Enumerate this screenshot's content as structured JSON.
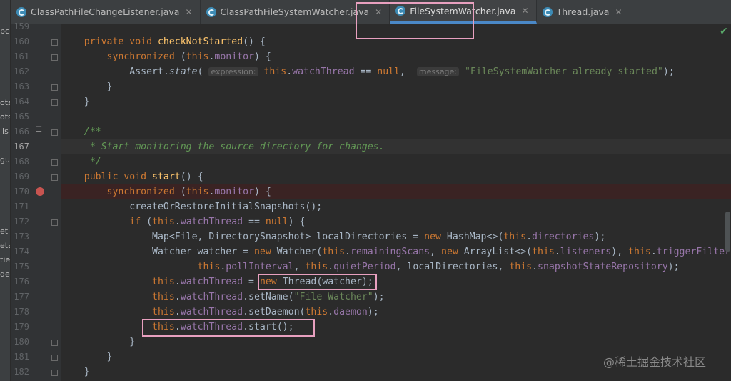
{
  "tabs": [
    {
      "label": "ClassPathFileChangeListener.java",
      "active": false
    },
    {
      "label": "ClassPathFileSystemWatcher.java",
      "active": false
    },
    {
      "label": "FileSystemWatcher.java",
      "active": true
    },
    {
      "label": "Thread.java",
      "active": false
    }
  ],
  "left_panel_fragments": [
    "pc",
    "ots",
    "ots",
    "lis",
    "gui",
    "et",
    "eta",
    "tie",
    "de"
  ],
  "status": {
    "inspection_ok": "✔"
  },
  "watermark": "@稀土掘金技术社区",
  "lines": [
    {
      "n": "159",
      "html": ""
    },
    {
      "n": "160",
      "html": "    <span class=\"k\">private void </span><span class=\"f\">checkNotStarted</span>() {"
    },
    {
      "n": "161",
      "html": "        <span class=\"k\">synchronized </span>(<span class=\"k\">this</span>.<span class=\"fd\">monitor</span>) {"
    },
    {
      "n": "162",
      "html": "            Assert.<span class=\"m\">state</span>( <span class=\"hint\">expression:</span> <span class=\"k\">this</span>.<span class=\"fd\">watchThread</span> == <span class=\"k\">null</span>,  <span class=\"hint\">message:</span> <span class=\"s\">\"FileSystemWatcher already started\"</span>);"
    },
    {
      "n": "163",
      "html": "        }"
    },
    {
      "n": "164",
      "html": "    }"
    },
    {
      "n": "165",
      "html": ""
    },
    {
      "n": "166",
      "html": "    <span class=\"c\">/**</span>"
    },
    {
      "n": "167",
      "html": "<span class=\"c\">     * Start monitoring the source directory for changes.</span><span class=\"caret\"></span>"
    },
    {
      "n": "168",
      "html": "<span class=\"c\">     */</span>"
    },
    {
      "n": "169",
      "html": "    <span class=\"k\">public void </span><span class=\"f\">start</span>() {"
    },
    {
      "n": "170",
      "html": "        <span class=\"k\">synchronized </span>(<span class=\"k\">this</span>.<span class=\"fd\">monitor</span>) {"
    },
    {
      "n": "171",
      "html": "            createOrRestoreInitialSnapshots();"
    },
    {
      "n": "172",
      "html": "            <span class=\"k\">if </span>(<span class=\"k\">this</span>.<span class=\"fd\">watchThread</span> == <span class=\"k\">null</span>) {"
    },
    {
      "n": "173",
      "html": "                Map&lt;File, DirectorySnapshot&gt; localDirectories = <span class=\"k\">new </span>HashMap&lt;&gt;(<span class=\"k\">this</span>.<span class=\"fd\">directories</span>);"
    },
    {
      "n": "174",
      "html": "                Watcher watcher = <span class=\"k\">new </span>Watcher(<span class=\"k\">this</span>.<span class=\"fd\">remainingScans</span>, <span class=\"k\">new </span>ArrayList&lt;&gt;(<span class=\"k\">this</span>.<span class=\"fd\">listeners</span>), <span class=\"k\">this</span>.<span class=\"fd\">triggerFilter</span>,"
    },
    {
      "n": "175",
      "html": "                        <span class=\"k\">this</span>.<span class=\"fd\">pollInterval</span>, <span class=\"k\">this</span>.<span class=\"fd\">quietPeriod</span>, localDirectories, <span class=\"k\">this</span>.<span class=\"fd\">snapshotStateRepository</span>);"
    },
    {
      "n": "176",
      "html": "                <span class=\"k\">this</span>.<span class=\"fd\">watchThread</span> = <span class=\"k\">new </span>Thread(watcher);"
    },
    {
      "n": "177",
      "html": "                <span class=\"k\">this</span>.<span class=\"fd\">watchThread</span>.setName(<span class=\"s\">\"File Watcher\"</span>);"
    },
    {
      "n": "178",
      "html": "                <span class=\"k\">this</span>.<span class=\"fd\">watchThread</span>.setDaemon(<span class=\"k\">this</span>.<span class=\"fd\">daemon</span>);"
    },
    {
      "n": "179",
      "html": "                <span class=\"k\">this</span>.<span class=\"fd\">watchThread</span>.start();"
    },
    {
      "n": "180",
      "html": "            }"
    },
    {
      "n": "181",
      "html": "        }"
    },
    {
      "n": "182",
      "html": "    }"
    }
  ]
}
